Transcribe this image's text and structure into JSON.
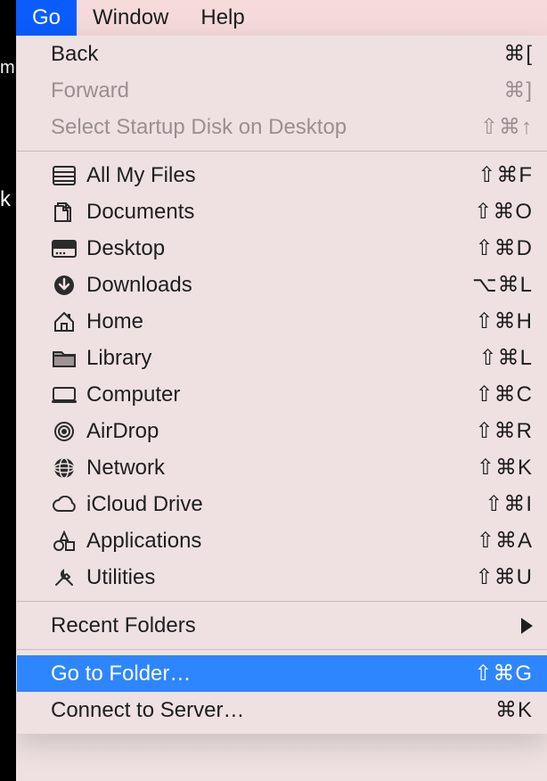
{
  "menubar": {
    "go": "Go",
    "window": "Window",
    "help": "Help"
  },
  "menu": {
    "back": {
      "label": "Back",
      "shortcut": "⌘["
    },
    "forward": {
      "label": "Forward",
      "shortcut": "⌘]"
    },
    "startup": {
      "label": "Select Startup Disk on Desktop",
      "shortcut": "⇧⌘↑"
    },
    "allmyfiles": {
      "label": "All My Files",
      "shortcut": "⇧⌘F"
    },
    "documents": {
      "label": "Documents",
      "shortcut": "⇧⌘O"
    },
    "desktop": {
      "label": "Desktop",
      "shortcut": "⇧⌘D"
    },
    "downloads": {
      "label": "Downloads",
      "shortcut": "⌥⌘L"
    },
    "home": {
      "label": "Home",
      "shortcut": "⇧⌘H"
    },
    "library": {
      "label": "Library",
      "shortcut": "⇧⌘L"
    },
    "computer": {
      "label": "Computer",
      "shortcut": "⇧⌘C"
    },
    "airdrop": {
      "label": "AirDrop",
      "shortcut": "⇧⌘R"
    },
    "network": {
      "label": "Network",
      "shortcut": "⇧⌘K"
    },
    "icloud": {
      "label": "iCloud Drive",
      "shortcut": "⇧⌘I"
    },
    "applications": {
      "label": "Applications",
      "shortcut": "⇧⌘A"
    },
    "utilities": {
      "label": "Utilities",
      "shortcut": "⇧⌘U"
    },
    "recent": {
      "label": "Recent Folders"
    },
    "gotofolder": {
      "label": "Go to Folder…",
      "shortcut": "⇧⌘G"
    },
    "connect": {
      "label": "Connect to Server…",
      "shortcut": "⌘K"
    }
  },
  "bg": {
    "m": "m",
    "k": "k"
  }
}
